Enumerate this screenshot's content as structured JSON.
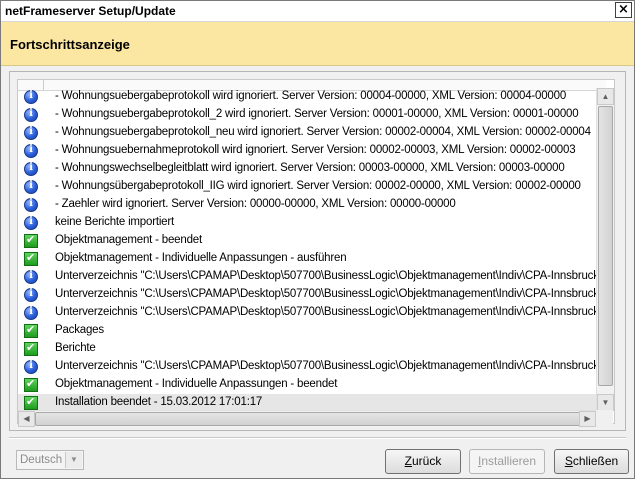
{
  "window": {
    "title": "netFrameserver Setup/Update",
    "close_glyph": "×"
  },
  "header": {
    "heading": "Fortschrittsanzeige"
  },
  "log": {
    "rows": [
      {
        "type": "info",
        "text": "- Wohnungsuebergabeprotokoll wird ignoriert. Server Version: 00004-00000, XML Version: 00004-00000"
      },
      {
        "type": "info",
        "text": "- Wohnungsuebergabeprotokoll_2 wird ignoriert. Server Version: 00001-00000, XML Version: 00001-00000"
      },
      {
        "type": "info",
        "text": "- Wohnungsuebergabeprotokoll_neu wird ignoriert. Server Version: 00002-00004, XML Version: 00002-00004"
      },
      {
        "type": "info",
        "text": "- Wohnungsuebernahmeprotokoll wird ignoriert. Server Version: 00002-00003, XML Version: 00002-00003"
      },
      {
        "type": "info",
        "text": "- Wohnungswechselbegleitblatt wird ignoriert. Server Version: 00003-00000, XML Version: 00003-00000"
      },
      {
        "type": "info",
        "text": "- Wohnungsübergabeprotokoll_IIG wird ignoriert. Server Version: 00002-00000, XML Version: 00002-00000"
      },
      {
        "type": "info",
        "text": "- Zaehler wird ignoriert. Server Version: 00000-00000, XML Version: 00000-00000"
      },
      {
        "type": "info",
        "text": "keine Berichte importiert"
      },
      {
        "type": "ok",
        "text": "Objektmanagement - beendet"
      },
      {
        "type": "ok",
        "text": "Objektmanagement - Individuelle Anpassungen - ausführen"
      },
      {
        "type": "info",
        "text": "Unterverzeichnis \"C:\\Users\\CPAMAP\\Desktop\\507700\\BusinessLogic\\Objektmanagement\\Indiv\\CPA-Innsbruck..."
      },
      {
        "type": "info",
        "text": "Unterverzeichnis \"C:\\Users\\CPAMAP\\Desktop\\507700\\BusinessLogic\\Objektmanagement\\Indiv\\CPA-Innsbruck..."
      },
      {
        "type": "info",
        "text": "Unterverzeichnis \"C:\\Users\\CPAMAP\\Desktop\\507700\\BusinessLogic\\Objektmanagement\\Indiv\\CPA-Innsbruck..."
      },
      {
        "type": "ok",
        "text": "Packages"
      },
      {
        "type": "ok",
        "text": "Berichte"
      },
      {
        "type": "info",
        "text": "Unterverzeichnis \"C:\\Users\\CPAMAP\\Desktop\\507700\\BusinessLogic\\Objektmanagement\\Indiv\\CPA-Innsbruck..."
      },
      {
        "type": "ok",
        "text": "Objektmanagement - Individuelle Anpassungen - beendet"
      },
      {
        "type": "ok",
        "text": "Installation beendet - 15.03.2012 17:01:17",
        "highlight": true
      }
    ]
  },
  "footer": {
    "language": "Deutsch",
    "back_label": "Zurück",
    "back_mnemonic": "Z",
    "back_rest": "urück",
    "install_label": "Installieren",
    "install_mnemonic": "I",
    "install_rest": "nstallieren",
    "close_label": "Schließen",
    "close_mnemonic": "S",
    "close_rest": "chließen"
  },
  "colors": {
    "header_bg": "#fbe7a2",
    "info_icon": "#2b5fd8",
    "ok_icon": "#1e9c1e"
  },
  "icons": {
    "info": "info-icon",
    "ok": "checkmark-icon",
    "dropdown": "chevron-down-icon",
    "scroll_up": "arrow-up-icon",
    "scroll_down": "arrow-down-icon",
    "scroll_left": "arrow-left-icon",
    "scroll_right": "arrow-right-icon"
  }
}
